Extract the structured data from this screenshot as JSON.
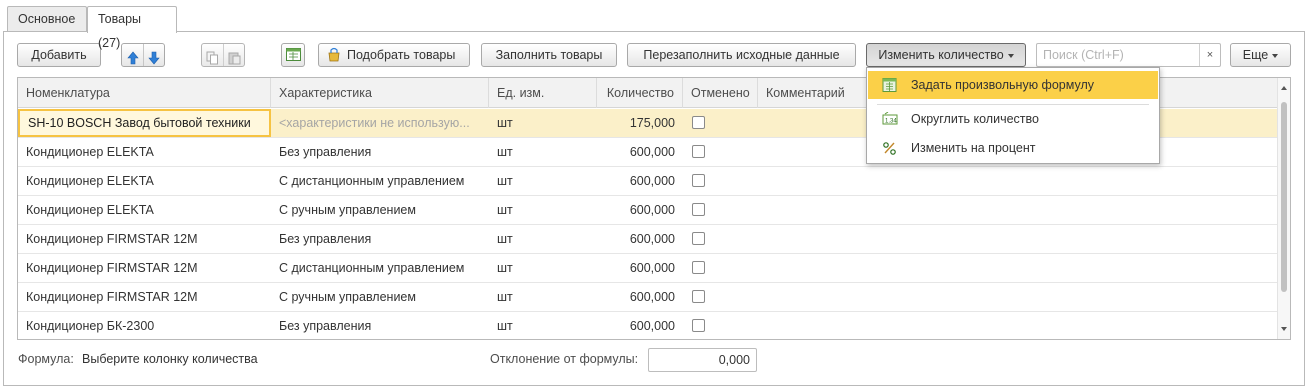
{
  "tabs": [
    {
      "label": "Основное"
    },
    {
      "label": "Товары (27)"
    }
  ],
  "toolbar": {
    "add_label": "Добавить",
    "pick_goods_label": "Подобрать товары",
    "fill_goods_label": "Заполнить товары",
    "refill_label": "Перезаполнить исходные данные",
    "change_qty_label": "Изменить количество",
    "more_label": "Еще",
    "search_placeholder": "Поиск (Ctrl+F)",
    "search_clear": "×"
  },
  "menu": {
    "items": [
      {
        "label": "Задать произвольную формулу",
        "icon": "formula-icon",
        "highlighted": true
      },
      {
        "label": "Округлить количество",
        "icon": "round-icon",
        "highlighted": false
      },
      {
        "label": "Изменить на процент",
        "icon": "percent-icon",
        "highlighted": false
      }
    ]
  },
  "table": {
    "columns": [
      "Номенклатура",
      "Характеристика",
      "Ед. изм.",
      "Количество",
      "Отменено",
      "Комментарий"
    ],
    "rows": [
      {
        "item": "SH-10 BOSCH Завод бытовой техники",
        "char": "<характеристики не использую...",
        "unit": "шт",
        "qty": "175,000",
        "cancelled": false,
        "comment": ""
      },
      {
        "item": "Кондиционер ELEKTA",
        "char": "Без управления",
        "unit": "шт",
        "qty": "600,000",
        "cancelled": false,
        "comment": ""
      },
      {
        "item": "Кондиционер ELEKTA",
        "char": "С дистанционным управлением",
        "unit": "шт",
        "qty": "600,000",
        "cancelled": false,
        "comment": ""
      },
      {
        "item": "Кондиционер ELEKTA",
        "char": "С ручным управлением",
        "unit": "шт",
        "qty": "600,000",
        "cancelled": false,
        "comment": ""
      },
      {
        "item": "Кондиционер FIRMSTAR 12M",
        "char": "Без управления",
        "unit": "шт",
        "qty": "600,000",
        "cancelled": false,
        "comment": ""
      },
      {
        "item": "Кондиционер FIRMSTAR 12M",
        "char": "С дистанционным управлением",
        "unit": "шт",
        "qty": "600,000",
        "cancelled": false,
        "comment": ""
      },
      {
        "item": "Кондиционер FIRMSTAR 12M",
        "char": "С ручным управлением",
        "unit": "шт",
        "qty": "600,000",
        "cancelled": false,
        "comment": ""
      },
      {
        "item": "Кондиционер БК-2300",
        "char": "Без управления",
        "unit": "шт",
        "qty": "600,000",
        "cancelled": false,
        "comment": ""
      }
    ]
  },
  "footer": {
    "formula_label": "Формула:",
    "formula_value": "Выберите колонку количества",
    "deviation_label": "Отклонение от формулы:",
    "deviation_value": "0,000"
  },
  "colors": {
    "accent": "#fbd048",
    "selected_row": "#fbf0c9",
    "focus_border": "#f6c342",
    "arrow_blue": "#2f7fd6"
  }
}
